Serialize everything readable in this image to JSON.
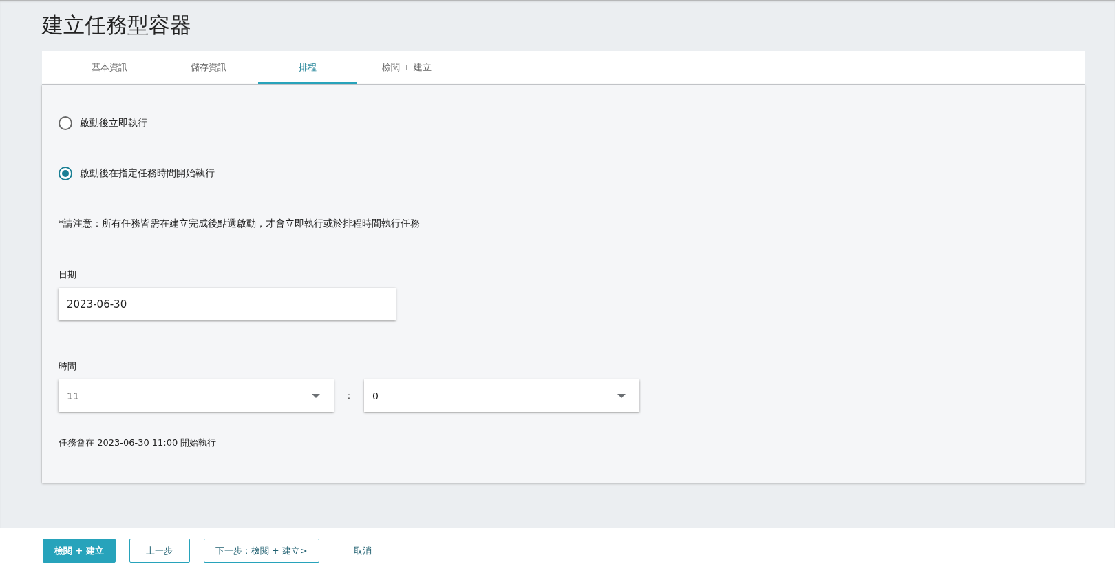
{
  "page": {
    "title": "建立任務型容器"
  },
  "tabs": [
    {
      "label": "基本資訊",
      "selected": false
    },
    {
      "label": "儲存資訊",
      "selected": false
    },
    {
      "label": "排程",
      "selected": true
    },
    {
      "label": "檢閱 + 建立",
      "selected": false
    }
  ],
  "schedule_options": [
    {
      "label": "啟動後立即執行",
      "selected": false
    },
    {
      "label": "啟動後在指定任務時間開始執行",
      "selected": true
    }
  ],
  "note": "*請注意：所有任務皆需在建立完成後點選啟動，才會立即執行或於排程時間執行任務",
  "date": {
    "label": "日期",
    "value": "2023-06-30"
  },
  "time": {
    "label": "時間",
    "hour": "11",
    "separator": ":",
    "minute": "0"
  },
  "summary": "任務會在 2023-06-30 11:00 開始執行",
  "buttons": [
    {
      "label": "檢閱 + 建立",
      "kind": "primary"
    },
    {
      "label": "上一步",
      "kind": "outline"
    },
    {
      "label": "下一步 : 檢閱 + 建立>",
      "kind": "outline"
    },
    {
      "label": "取消",
      "kind": "link"
    }
  ]
}
